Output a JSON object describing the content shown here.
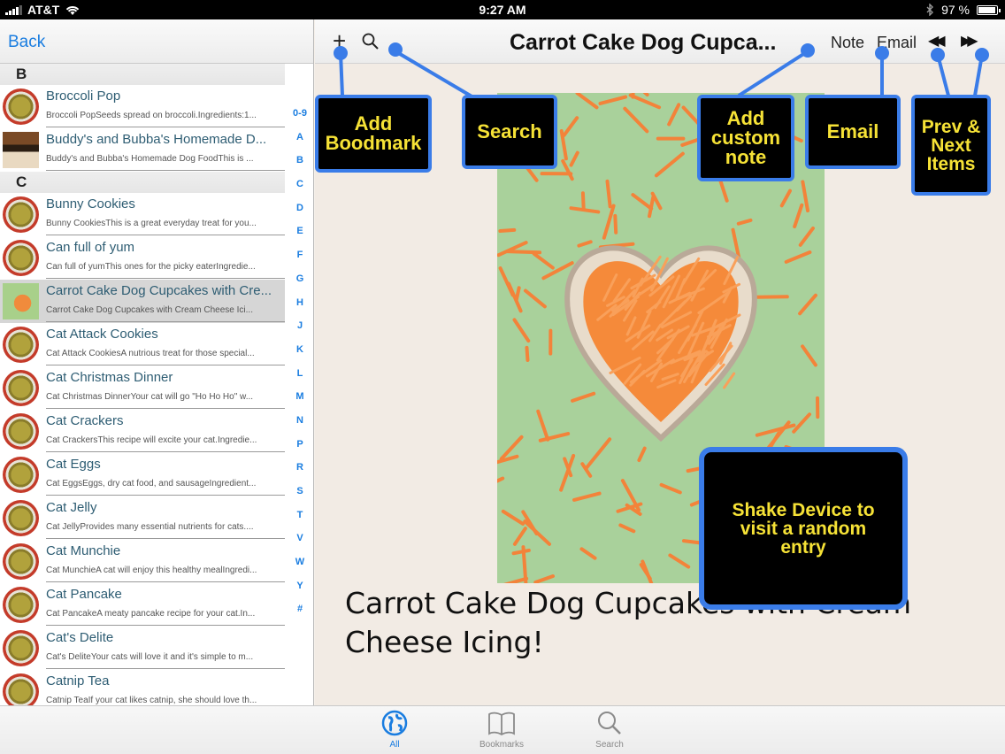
{
  "status_bar": {
    "carrier": "AT&T",
    "time": "9:27 AM",
    "battery": "97 %"
  },
  "sidebar": {
    "back_label": "Back",
    "sections": [
      {
        "letter": "B",
        "rows": [
          {
            "title": "Broccoli Pop",
            "subtitle": "Broccoli PopSeeds spread on broccoli.Ingredients:1...",
            "thumb": "bowl"
          },
          {
            "title": "Buddy's and Bubba's Homemade D...",
            "subtitle": "Buddy's and Bubba's Homemade Dog FoodThis is ...",
            "thumb": "photo"
          }
        ]
      },
      {
        "letter": "C",
        "rows": [
          {
            "title": "Bunny Cookies",
            "subtitle": "Bunny CookiesThis is a great everyday treat for you...",
            "thumb": "bowl"
          },
          {
            "title": "Can full of yum",
            "subtitle": "Can full of yumThis ones for the picky eaterIngredie...",
            "thumb": "bowl"
          },
          {
            "title": "Carrot Cake Dog Cupcakes with Cre...",
            "subtitle": "Carrot Cake Dog Cupcakes with Cream Cheese Ici...",
            "thumb": "cake",
            "selected": true
          },
          {
            "title": "Cat Attack Cookies",
            "subtitle": "Cat Attack CookiesA nutrious treat for those special...",
            "thumb": "bowl"
          },
          {
            "title": "Cat Christmas Dinner",
            "subtitle": "Cat Christmas DinnerYour cat will go \"Ho Ho Ho\" w...",
            "thumb": "bowl"
          },
          {
            "title": "Cat Crackers",
            "subtitle": "Cat CrackersThis recipe will excite your cat.Ingredie...",
            "thumb": "bowl"
          },
          {
            "title": "Cat Eggs",
            "subtitle": "Cat EggsEggs, dry cat food, and sausageIngredient...",
            "thumb": "bowl"
          },
          {
            "title": "Cat Jelly",
            "subtitle": "Cat JellyProvides many essential nutrients for cats....",
            "thumb": "bowl"
          },
          {
            "title": "Cat Munchie",
            "subtitle": "Cat MunchieA cat will enjoy this healthy mealIngredi...",
            "thumb": "bowl"
          },
          {
            "title": "Cat Pancake",
            "subtitle": "Cat PancakeA meaty pancake recipe for your cat.In...",
            "thumb": "bowl"
          },
          {
            "title": "Cat's Delite",
            "subtitle": "Cat's DeliteYour cats will love it and it's simple to m...",
            "thumb": "bowl"
          },
          {
            "title": "Catnip Tea",
            "subtitle": "Catnip TeaIf your cat likes catnip, she should love th...",
            "thumb": "bowl"
          }
        ]
      }
    ],
    "index": [
      "0-9",
      "A",
      "B",
      "C",
      "D",
      "E",
      "F",
      "G",
      "H",
      "J",
      "K",
      "L",
      "M",
      "N",
      "P",
      "R",
      "S",
      "T",
      "V",
      "W",
      "Y",
      "#"
    ]
  },
  "nav": {
    "add_icon": "plus-icon",
    "search_icon": "magnifier-icon",
    "title": "Carrot Cake Dog Cupca...",
    "note_label": "Note",
    "email_label": "Email",
    "prev_label": "◀◀",
    "next_label": "▶▶"
  },
  "content": {
    "recipe_title": "Carrot Cake Dog Cupcakes with Cream Cheese Icing!"
  },
  "callouts": {
    "bookmark": "Add Boodmark",
    "search": "Search",
    "note": "Add custom note",
    "email": "Email",
    "prevnext": "Prev & Next Items",
    "shake": "Shake Device to visit a random entry"
  },
  "tabbar": {
    "tabs": [
      {
        "label": "All",
        "icon": "globe-icon",
        "active": true
      },
      {
        "label": "Bookmarks",
        "icon": "book-icon",
        "active": false
      },
      {
        "label": "Search",
        "icon": "magnifier-icon",
        "active": false
      }
    ]
  },
  "colors": {
    "accent": "#1a7de0",
    "callout_border": "#3a7ce8",
    "callout_text": "#f6e236"
  }
}
